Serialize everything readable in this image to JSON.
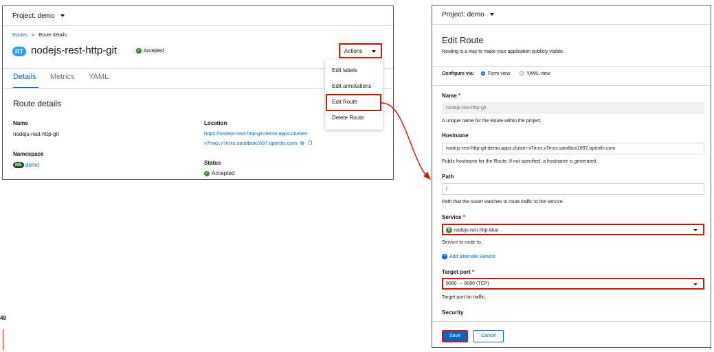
{
  "left": {
    "project_label": "Project: demo",
    "breadcrumb": {
      "root": "Routes",
      "separator": ">",
      "current": "Route details"
    },
    "resource_badge": "RT",
    "route_name": "nodejs-rest-http-git",
    "status_pill": "Accepted",
    "actions_label": "Actions",
    "tabs": [
      "Details",
      "Metrics",
      "YAML"
    ],
    "section_title": "Route details",
    "name_label": "Name",
    "name_value": "nodejs-rest-http-git",
    "namespace_label": "Namespace",
    "namespace_badge": "NS",
    "namespace_value": "demo",
    "location_label": "Location",
    "location_line1": "https://nodejs-rest-http-git-demo.apps.cluster-",
    "location_line2": "v7mxs.v7mxs.sandbox1697.opentlc.com",
    "status_label": "Status",
    "status_value": "Accepted",
    "menu_items": [
      "Edit labels",
      "Edit annotations",
      "Edit Route",
      "Delete Route"
    ]
  },
  "page_number": "48",
  "right": {
    "project_label": "Project: demo",
    "title": "Edit Route",
    "subtitle": "Routing is a way to make your application publicly visible.",
    "configure_via": "Configure via:",
    "form_view": "Form view",
    "yaml_view": "YAML view",
    "name_label": "Name",
    "name_value": "nodejs-rest-http-git",
    "name_help": "A unique name for the Route within the project.",
    "hostname_label": "Hostname",
    "hostname_value": "nodejs-rest-http-git-demo.apps.cluster-v7mxs.v7mxs.sandbox1697.opentlc.com",
    "hostname_help": "Public hostname for the Route. If not specified, a hostname is generated.",
    "path_label": "Path",
    "path_value": "/",
    "path_help": "Path that the router watches to route traffic to the service.",
    "service_label": "Service",
    "service_icon_letter": "S",
    "service_value": "nodejs-rest-http-blue",
    "service_help": "Service to route to.",
    "add_alternate": "Add alternate Service",
    "target_port_label": "Target port",
    "target_port_value": "8080 → 8080 (TCP)",
    "target_port_help": "Target port for traffic.",
    "security_label": "Security",
    "save_label": "Save",
    "cancel_label": "Cancel",
    "required_mark": "*"
  },
  "colors": {
    "accent": "#0066cc",
    "highlight": "#c9190b",
    "success": "#3e8635",
    "rt_badge": "#2b9af3",
    "ns_badge": "#1e4f18"
  }
}
